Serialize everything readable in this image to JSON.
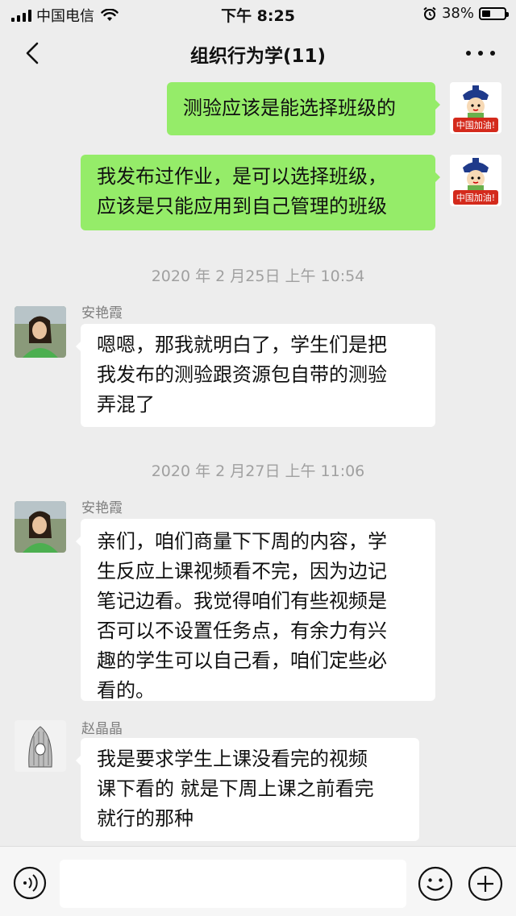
{
  "status_bar": {
    "carrier": "中国电信",
    "time": "下午 8:25",
    "battery_percent": "38%",
    "battery_level": 0.38
  },
  "nav": {
    "title": "组织行为学(11)",
    "back_icon": "chevron-left-icon",
    "more_icon": "more-dots-icon"
  },
  "messages": [
    {
      "type": "out",
      "text": "测验应该是能选择班级的",
      "avatar_caption": "中国加油!"
    },
    {
      "type": "out",
      "text": "我发布过作业，是可以选择班级，\n应该是只能应用到自己管理的班级",
      "avatar_caption": "中国加油!"
    },
    {
      "type": "time",
      "text": "2020 年 2 月25日 上午 10:54"
    },
    {
      "type": "in",
      "sender": "安艳霞",
      "text": "嗯嗯，那我就明白了，学生们是把\n我发布的测验跟资源包自带的测验\n弄混了"
    },
    {
      "type": "time",
      "text": "2020 年 2 月27日 上午 11:06"
    },
    {
      "type": "in",
      "sender": "安艳霞",
      "text": "亲们，咱们商量下下周的内容，学\n生反应上课视频看不完，因为边记\n笔记边看。我觉得咱们有些视频是\n否可以不设置任务点，有余力有兴\n趣的学生可以自己看，咱们定些必\n看的。"
    },
    {
      "type": "in",
      "sender": "赵晶晶",
      "text": "我是要求学生上课没看完的视频\n课下看的 就是下周上课之前看完\n就行的那种"
    }
  ],
  "input_bar": {
    "voice_icon": "voice-icon",
    "emoji_icon": "emoji-icon",
    "plus_icon": "plus-icon",
    "input_value": ""
  },
  "colors": {
    "background": "#ededed",
    "outgoing_bubble": "#95ec69",
    "incoming_bubble": "#ffffff",
    "avatar_red": "#d42a1c"
  }
}
